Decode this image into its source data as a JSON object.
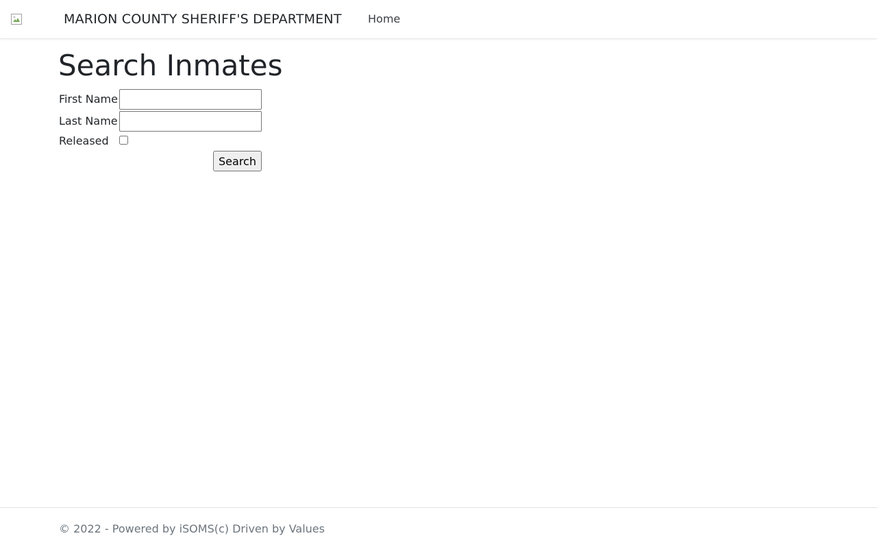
{
  "header": {
    "logo_icon": "broken-image-icon",
    "brand": "MARION COUNTY SHERIFF'S DEPARTMENT",
    "nav": {
      "home": "Home"
    }
  },
  "main": {
    "title": "Search Inmates",
    "form": {
      "first_name_label": "First Name",
      "first_name_value": "",
      "last_name_label": "Last Name",
      "last_name_value": "",
      "released_label": "Released",
      "released_checked": false,
      "search_label": "Search"
    }
  },
  "footer": {
    "text": "© 2022 - Powered by iSOMS(c) Driven by Values"
  },
  "colors": {
    "text": "#212529",
    "muted": "#6c757d",
    "border": "#dee2e6"
  }
}
